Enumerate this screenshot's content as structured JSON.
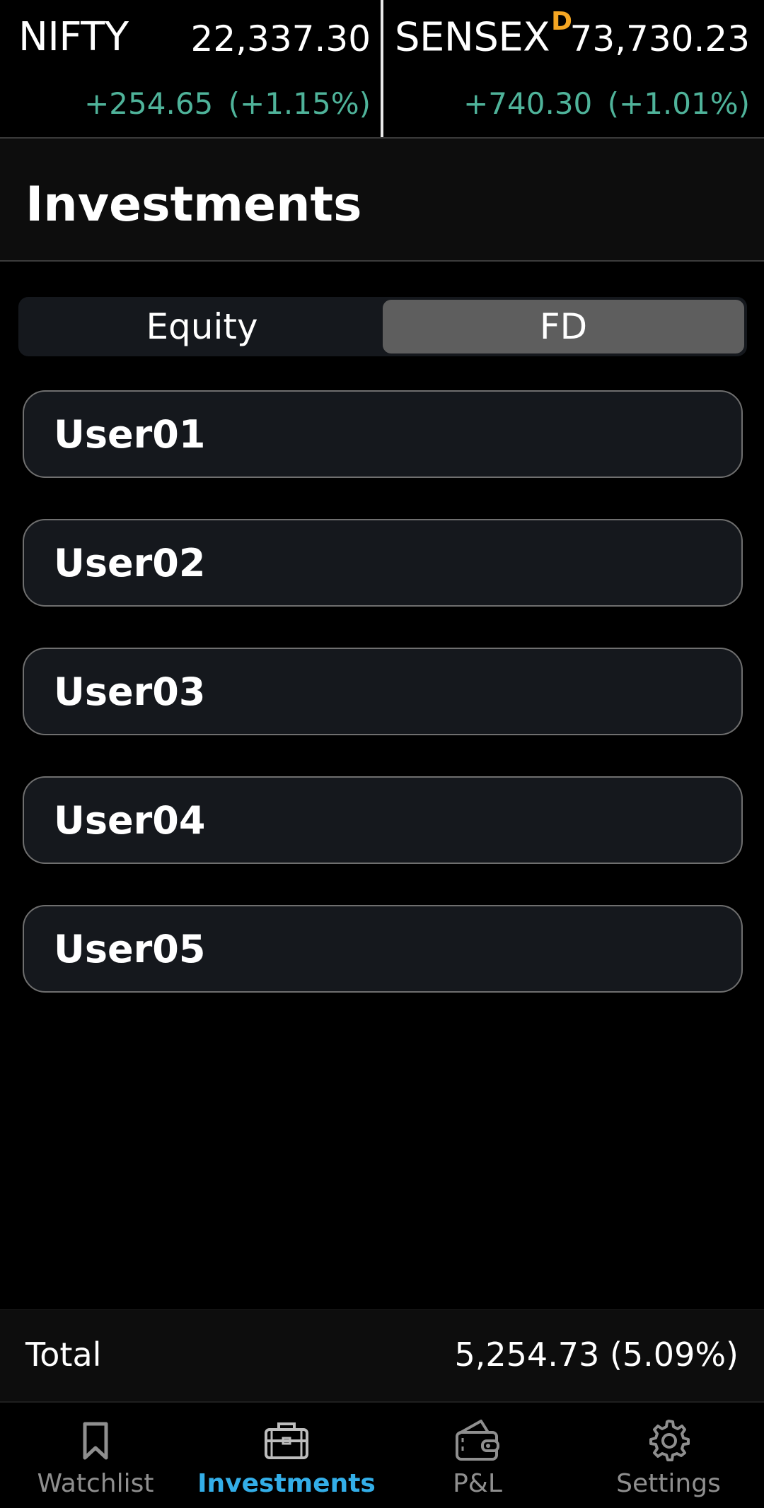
{
  "ticker": {
    "nifty": {
      "name": "NIFTY",
      "badge": "",
      "value": "22,337.30",
      "change": "+254.65  (+1.15%)"
    },
    "sensex": {
      "name": "SENSEX",
      "badge": "D",
      "value": "73,730.23",
      "change": "+740.30  (+1.01%)"
    },
    "positive_color": "#4fb39a",
    "badge_color": "#f5a623"
  },
  "page": {
    "title": "Investments"
  },
  "tabs": {
    "equity": "Equity",
    "fd": "FD",
    "active": "FD"
  },
  "users": [
    {
      "name": "User01"
    },
    {
      "name": "User02"
    },
    {
      "name": "User03"
    },
    {
      "name": "User04"
    },
    {
      "name": "User05"
    }
  ],
  "total": {
    "label": "Total",
    "value": "5,254.73 (5.09%)"
  },
  "nav": {
    "active_color": "#33aee8",
    "items": [
      {
        "label": "Watchlist",
        "icon": "bookmark-icon"
      },
      {
        "label": "Investments",
        "icon": "briefcase-icon"
      },
      {
        "label": "P&L",
        "icon": "wallet-icon"
      },
      {
        "label": "Settings",
        "icon": "gear-icon"
      }
    ]
  }
}
